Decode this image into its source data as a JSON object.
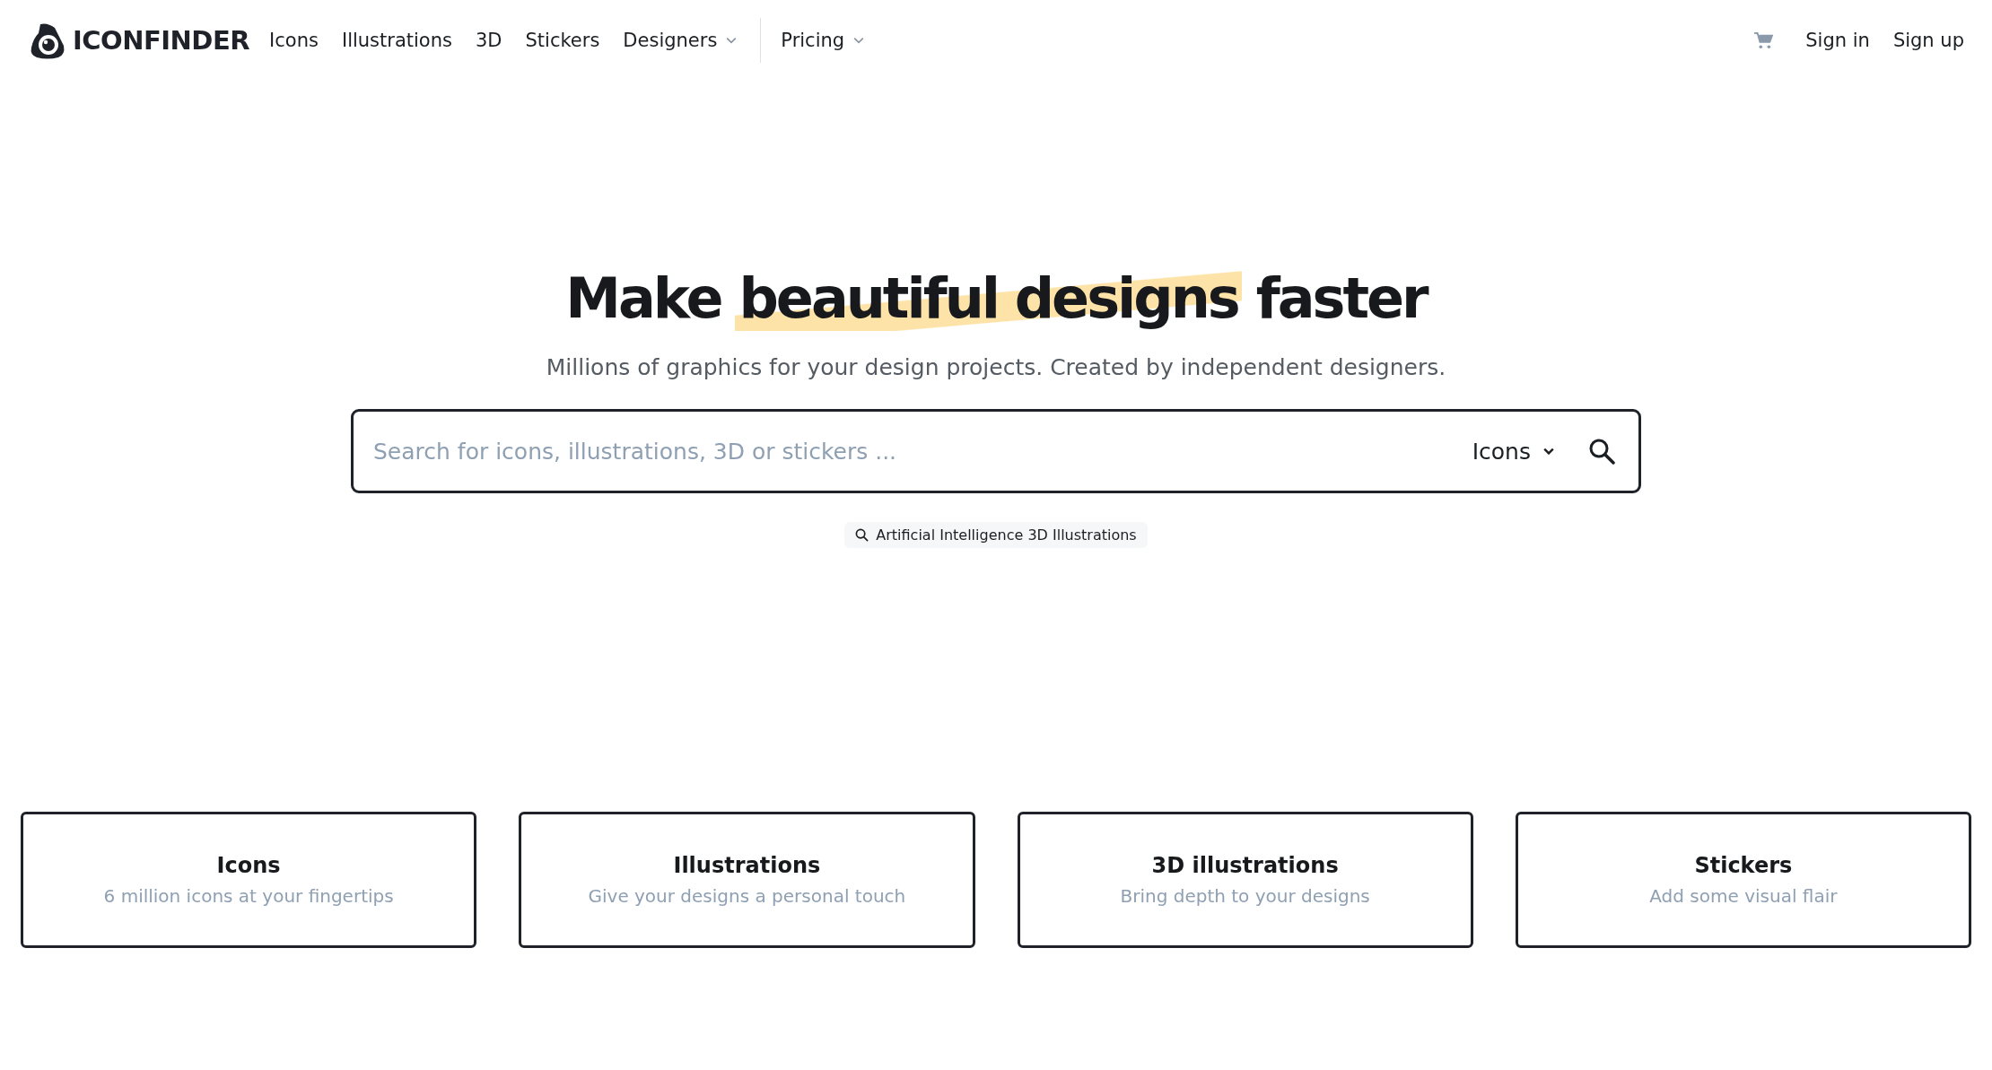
{
  "header": {
    "logo": "ICONFINDER",
    "nav": [
      {
        "label": "Icons",
        "dropdown": false
      },
      {
        "label": "Illustrations",
        "dropdown": false
      },
      {
        "label": "3D",
        "dropdown": false
      },
      {
        "label": "Stickers",
        "dropdown": false
      },
      {
        "label": "Designers",
        "dropdown": true
      }
    ],
    "nav_after_divider": [
      {
        "label": "Pricing",
        "dropdown": true
      }
    ],
    "actions": [
      "Sign in",
      "Sign up"
    ]
  },
  "hero": {
    "title_before": "Make",
    "title_highlight": "beautiful designs",
    "title_after": "faster",
    "subtitle": "Millions of graphics for your design projects. Created by independent designers.",
    "search": {
      "placeholder": "Search for icons, illustrations, 3D or stickers ...",
      "type": "Icons"
    },
    "suggestions": [
      "Artificial Intelligence 3D Illustrations"
    ]
  },
  "cards": [
    {
      "title": "Icons",
      "subtitle": "6 million icons at your fingertips"
    },
    {
      "title": "Illustrations",
      "subtitle": "Give your designs a personal touch"
    },
    {
      "title": "3D illustrations",
      "subtitle": "Bring depth to your designs"
    },
    {
      "title": "Stickers",
      "subtitle": "Add some visual flair"
    }
  ]
}
